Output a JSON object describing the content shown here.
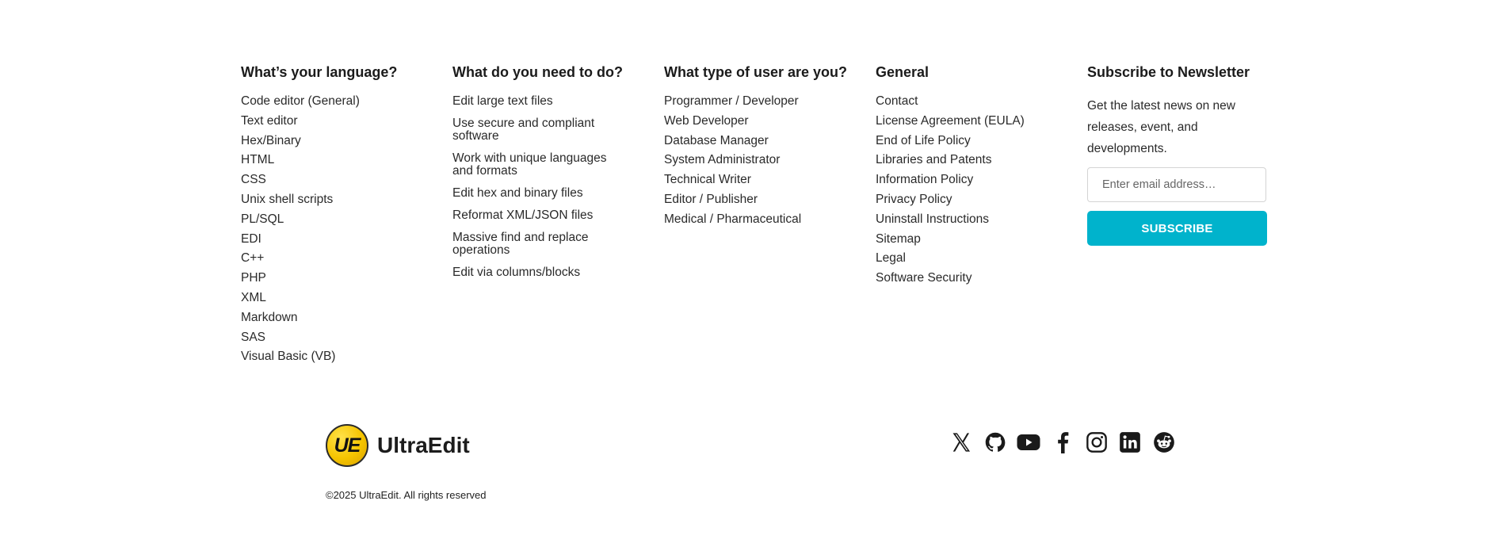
{
  "columns": {
    "language": {
      "title": "What’s your language?",
      "items": [
        "Code editor (General)",
        "Text editor",
        "Hex/Binary",
        "HTML",
        "CSS",
        "Unix shell scripts",
        "PL/SQL",
        "EDI",
        "C++",
        "PHP",
        "XML",
        "Markdown",
        "SAS",
        "Visual Basic (VB)"
      ]
    },
    "todo": {
      "title": "What do you need to do?",
      "items": [
        "Edit large text files",
        "Use secure and compliant software",
        "Work with unique languages and formats",
        "Edit hex and binary files",
        "Reformat XML/JSON files",
        "Massive find and replace operations",
        "Edit via columns/blocks"
      ]
    },
    "user_type": {
      "title": "What type of user are you?",
      "items": [
        "Programmer / Developer",
        "Web Developer",
        "Database Manager",
        "System Administrator",
        "Technical Writer",
        "Editor / Publisher",
        "Medical / Pharmaceutical"
      ]
    },
    "general": {
      "title": "General",
      "items": [
        "Contact",
        "License Agreement (EULA)",
        "End of Life Policy",
        "Libraries and Patents",
        "Information Policy",
        "Privacy Policy",
        "Uninstall Instructions",
        "Sitemap",
        "Legal",
        "Software Security"
      ]
    }
  },
  "newsletter": {
    "title": "Subscribe to Newsletter",
    "description": "Get the latest news on new releases, event, and developments.",
    "email_placeholder": "Enter email address…",
    "subscribe_label": "SUBSCRIBE",
    "accent_color": "#00b3cc"
  },
  "brand": {
    "logo_initials": "UE",
    "name": "UltraEdit",
    "copyright": "©2025 UltraEdit. All rights reserved"
  },
  "social_icons": [
    "x-icon",
    "github-icon",
    "youtube-icon",
    "facebook-icon",
    "instagram-icon",
    "linkedin-icon",
    "reddit-icon"
  ]
}
